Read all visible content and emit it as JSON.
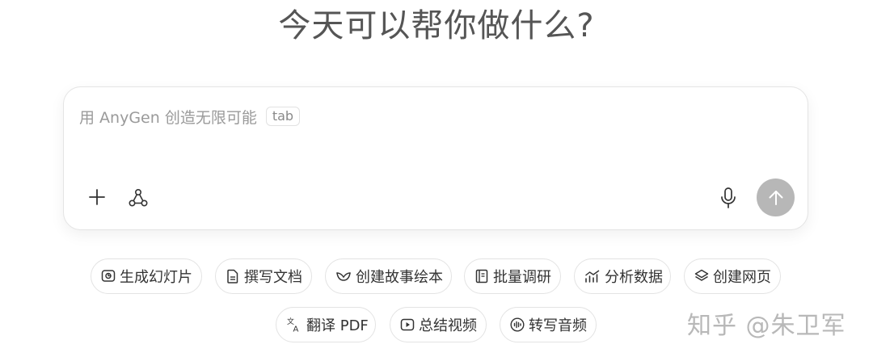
{
  "heading": "今天可以帮你做什么?",
  "composer": {
    "placeholder": "用 AnyGen 创造无限可能",
    "tab_hint": "tab",
    "icons": {
      "add": "plus-icon",
      "agent": "agent-nodes-icon",
      "voice": "microphone-icon",
      "send": "arrow-up-icon"
    },
    "send_button_color": "#b7b7b7"
  },
  "quick_actions": [
    {
      "label": "生成幻灯片",
      "icon": "slides-icon"
    },
    {
      "label": "撰写文档",
      "icon": "document-icon"
    },
    {
      "label": "创建故事绘本",
      "icon": "storybook-icon"
    },
    {
      "label": "批量调研",
      "icon": "research-icon"
    },
    {
      "label": "分析数据",
      "icon": "chart-icon"
    },
    {
      "label": "创建网页",
      "icon": "layers-icon"
    },
    {
      "label": "翻译 PDF",
      "icon": "translate-icon"
    },
    {
      "label": "总结视频",
      "icon": "video-icon"
    },
    {
      "label": "转写音频",
      "icon": "audio-wave-icon"
    }
  ],
  "watermark": "知乎 @朱卫军"
}
